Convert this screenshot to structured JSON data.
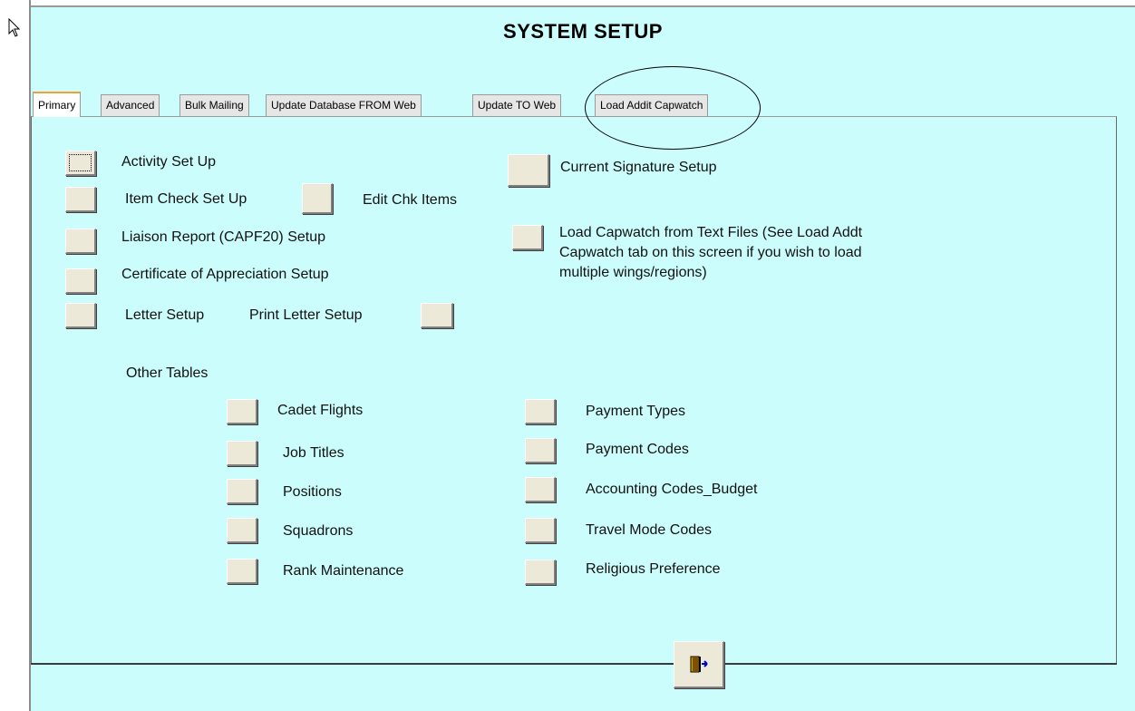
{
  "form": {
    "title": "SYSTEM SETUP"
  },
  "tabs": [
    {
      "label": "Primary"
    },
    {
      "label": "Advanced"
    },
    {
      "label": "Bulk Mailing"
    },
    {
      "label": "Update Database FROM Web"
    },
    {
      "label": "Update TO Web"
    },
    {
      "label": "Load Addit Capwatch"
    }
  ],
  "left_items": {
    "activity": "Activity Set Up",
    "item_check": "Item Check Set Up",
    "edit_chk": "Edit Chk Items",
    "liaison": "Liaison Report (CAPF20) Setup",
    "certificate": "Certificate of  Appreciation Setup",
    "letter": "Letter Setup",
    "print_letter": "Print Letter Setup"
  },
  "right_items": {
    "signature": "Current Signature Setup",
    "capwatch": "Load Capwatch from Text Files  (See Load Addt Capwatch tab on this screen if you wish to load multiple wings/regions)"
  },
  "other_tables": {
    "heading": "Other Tables",
    "col1": [
      "Cadet Flights",
      "Job Titles",
      "Positions",
      "Squadrons",
      "Rank Maintenance"
    ],
    "col2": [
      "Payment Types",
      "Payment Codes",
      "Accounting Codes_Budget",
      "Travel Mode Codes",
      "Religious Preference"
    ]
  },
  "icons": {
    "cursor": "mouse-pointer-icon",
    "exit": "exit-door-icon"
  },
  "colors": {
    "form_background": "#ccfdfd",
    "button_face": "#ece9d8",
    "active_tab_accent": "#f0a030"
  }
}
